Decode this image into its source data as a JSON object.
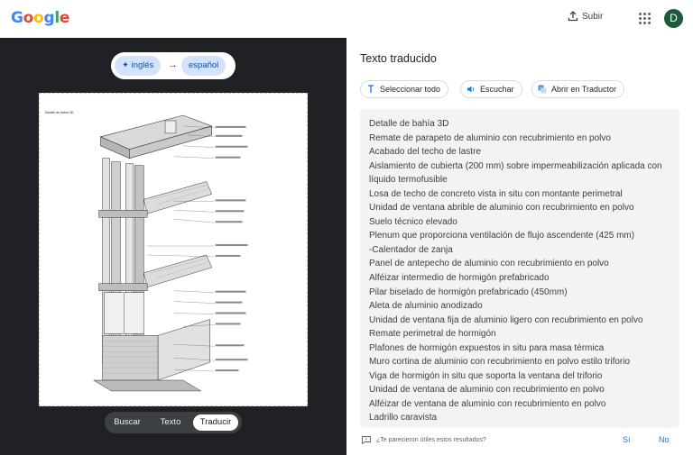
{
  "header": {
    "logo_letters": [
      "G",
      "o",
      "o",
      "g",
      "l",
      "e"
    ],
    "logo_colors": [
      "#4285F4",
      "#EA4335",
      "#FBBC05",
      "#4285F4",
      "#34A853",
      "#EA4335"
    ],
    "upload_label": "Subir",
    "upload_icon": "upload-icon",
    "apps_icon": "apps-grid-icon",
    "avatar_letter": "D",
    "avatar_color": "#1e5a3b"
  },
  "language": {
    "source": "inglés",
    "target": "español",
    "arrow": "→",
    "source_icon": "sparkle-icon"
  },
  "image": {
    "title": "Detalle de bahía 3D"
  },
  "modes": [
    {
      "label": "Buscar",
      "active": false
    },
    {
      "label": "Texto",
      "active": false
    },
    {
      "label": "Traducir",
      "active": true
    }
  ],
  "translated": {
    "title": "Texto traducido",
    "actions": [
      {
        "label": "Seleccionar todo",
        "icon": "text-select-icon"
      },
      {
        "label": "Escuchar",
        "icon": "speaker-icon"
      },
      {
        "label": "Abrir en Traductor",
        "icon": "translate-icon"
      }
    ],
    "lines": [
      "Detalle de bahía 3D",
      "Remate de parapeto de aluminio con recubrimiento en polvo",
      "Acabado del techo de lastre",
      "Aislamiento de cubierta (200 mm) sobre impermeabilización aplicada con líquido termofusible",
      "Losa de techo de concreto vista in situ con montante perimetral",
      "Unidad de ventana abrible de aluminio con recubrimiento en polvo",
      "Suelo técnico elevado",
      "Plenum que proporciona ventilación de flujo ascendente (425 mm)",
      "-Calentador de zanja",
      "Panel de antepecho de aluminio con recubrimiento en polvo",
      "Alféizar intermedio de hormigón prefabricado",
      "Pilar biselado de hormigón prefabricado (450mm)",
      "Aleta de aluminio anodizado",
      "Unidad de ventana fija de aluminio ligero con recubrimiento en polvo",
      "Remate perimetral de hormigón",
      "Plafones de hormigón expuestos in situ para masa térmica",
      "Muro cortina de aluminio con recubrimiento en polvo estilo triforio",
      "Viga de hormigón in situ que soporta la ventana del triforio",
      "Unidad de ventana de aluminio con recubrimiento en polvo",
      "Alféizar de ventana de aluminio con recubrimiento en polvo",
      "Ladrillo caravista"
    ]
  },
  "feedback": {
    "question": "¿Te parecieron útiles estos resultados?",
    "yes": "Sí",
    "no": "No",
    "icon": "feedback-icon"
  }
}
